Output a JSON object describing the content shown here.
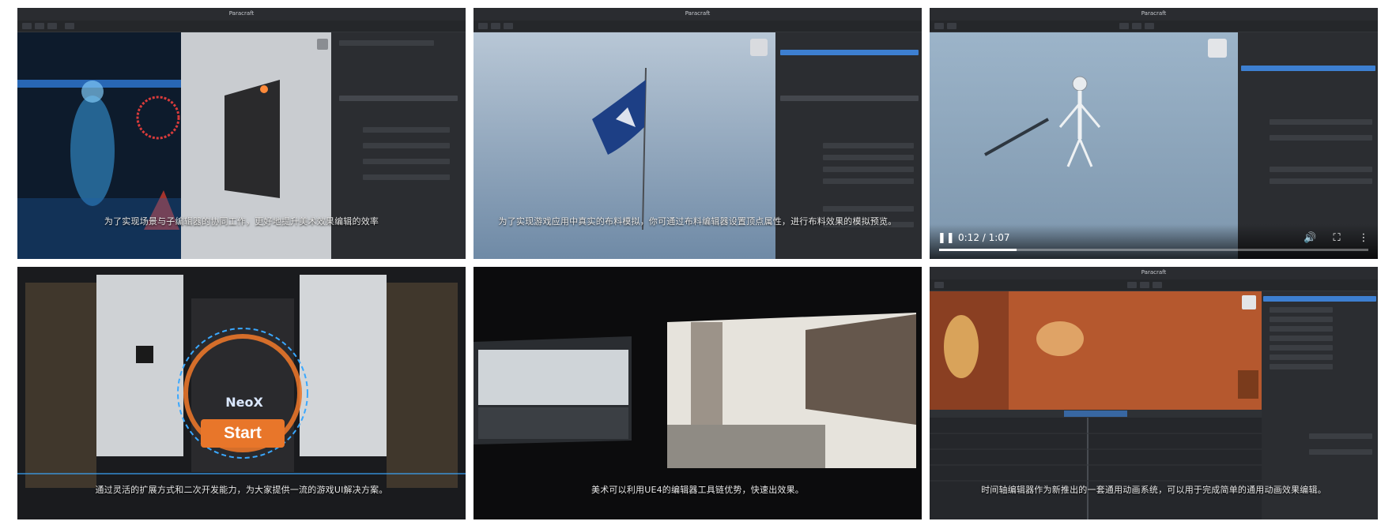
{
  "tiles": [
    {
      "title": "Paracraft",
      "caption": "为了实现场景与子编辑器的协同工作，更好地提升美术效果编辑的效率"
    },
    {
      "title": "Paracraft",
      "caption": "为了实现游戏应用中真实的布料模拟，你可通过布料编辑器设置顶点属性，进行布料效果的模拟预览。"
    },
    {
      "title": "Paracraft",
      "caption": "",
      "video": {
        "time_display": "0:12 / 1:07",
        "progress": 0.18,
        "pause_icon": "pause-icon",
        "volume_icon": "volume-icon",
        "fullscreen_icon": "fullscreen-icon",
        "more_icon": "more-vertical-icon"
      }
    },
    {
      "title": "",
      "caption": "通过灵活的扩展方式和二次开发能力，为大家提供一流的游戏UI解决方案。",
      "logo_text": "NeoX",
      "start_label": "Start"
    },
    {
      "title": "",
      "caption": "美术可以利用UE4的编辑器工具链优势，快速出效果。"
    },
    {
      "title": "Paracraft",
      "caption": "时间轴编辑器作为新推出的一套通用动画系统，可以用于完成简单的通用动画效果编辑。"
    }
  ],
  "colors": {
    "editor_bg": "#1d1f22",
    "panel_bg": "#2b2d31",
    "selection_blue": "#3d7fd1",
    "sky_blue": "#8aa3bd",
    "orange_bg": "#b5582e",
    "hologram_cyan": "#38b8ff",
    "start_orange": "#e8762a"
  }
}
